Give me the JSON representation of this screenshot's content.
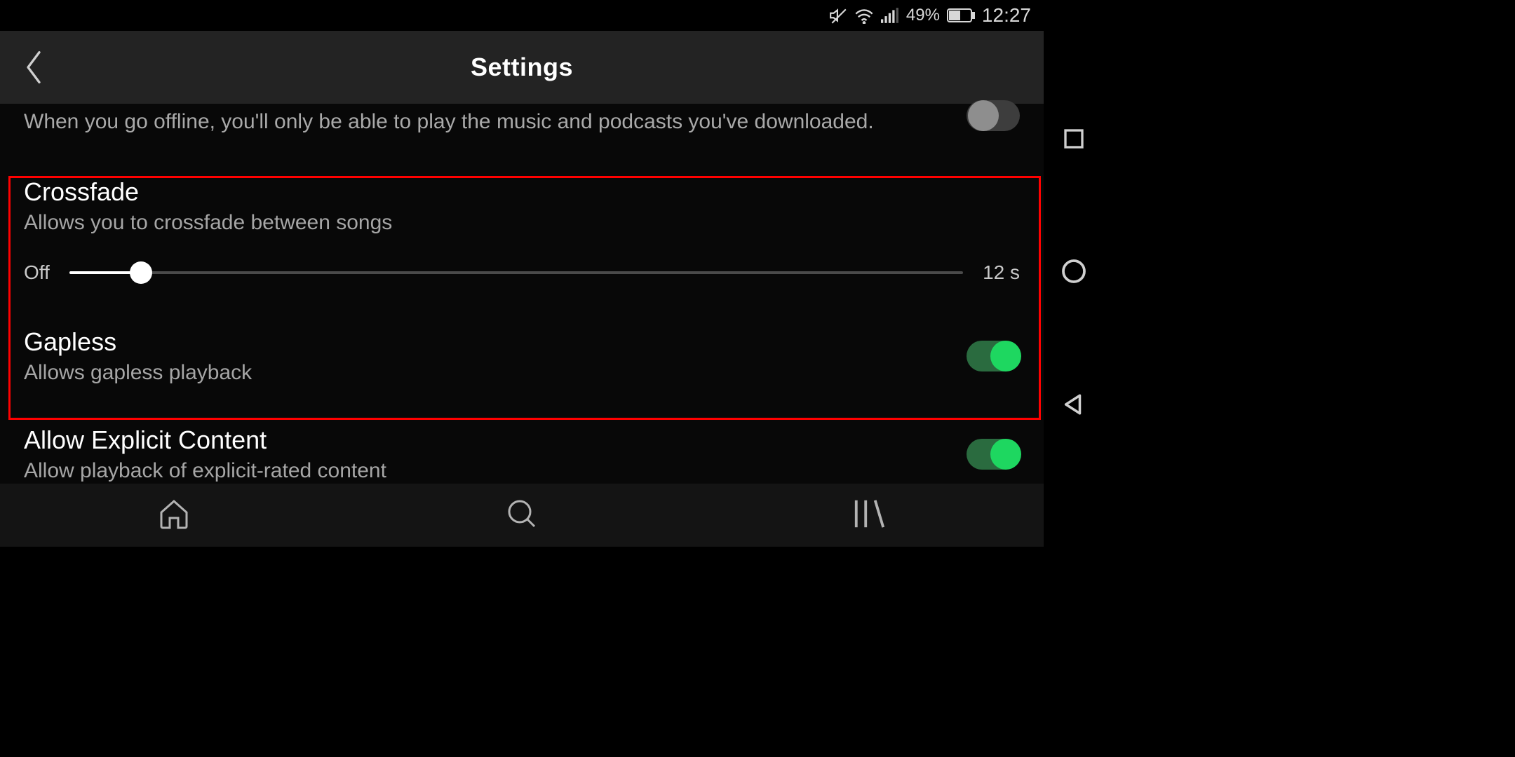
{
  "status_bar": {
    "battery_percent": "49%",
    "time": "12:27"
  },
  "header": {
    "title": "Settings"
  },
  "offline": {
    "description": "When you go offline, you'll only be able to play the music and podcasts you've downloaded.",
    "enabled": false
  },
  "crossfade": {
    "title": "Crossfade",
    "description": "Allows you to crossfade between songs",
    "min_label": "Off",
    "max_label": "12 s",
    "value_fraction": 0.08
  },
  "gapless": {
    "title": "Gapless",
    "description": "Allows gapless playback",
    "enabled": true
  },
  "explicit": {
    "title": "Allow Explicit Content",
    "description": "Allow playback of explicit-rated content",
    "enabled": true
  }
}
